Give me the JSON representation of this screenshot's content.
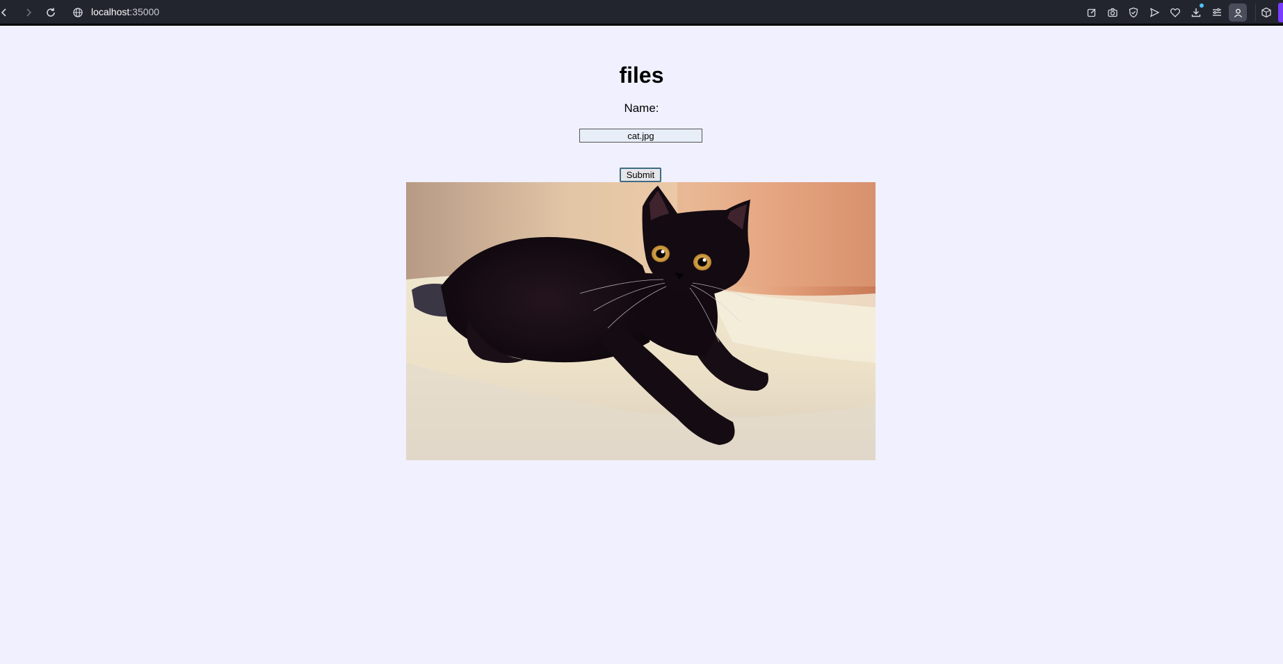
{
  "browser": {
    "url_host": "localhost",
    "url_port": ":35000",
    "icons": [
      "back-icon",
      "forward-icon",
      "reload-icon",
      "site-info-icon",
      "edit-icon",
      "camera-icon",
      "shield-icon",
      "send-icon",
      "heart-icon",
      "download-icon",
      "menu-icon",
      "account-icon",
      "extensions-icon"
    ]
  },
  "page": {
    "title": "files",
    "name_label": "Name:",
    "name_value": "cat.jpg",
    "submit_label": "Submit",
    "image_alt": "black cat lying on a bed"
  },
  "colors": {
    "page_background": "#f0f0ff",
    "toolbar_background": "#23252e"
  }
}
